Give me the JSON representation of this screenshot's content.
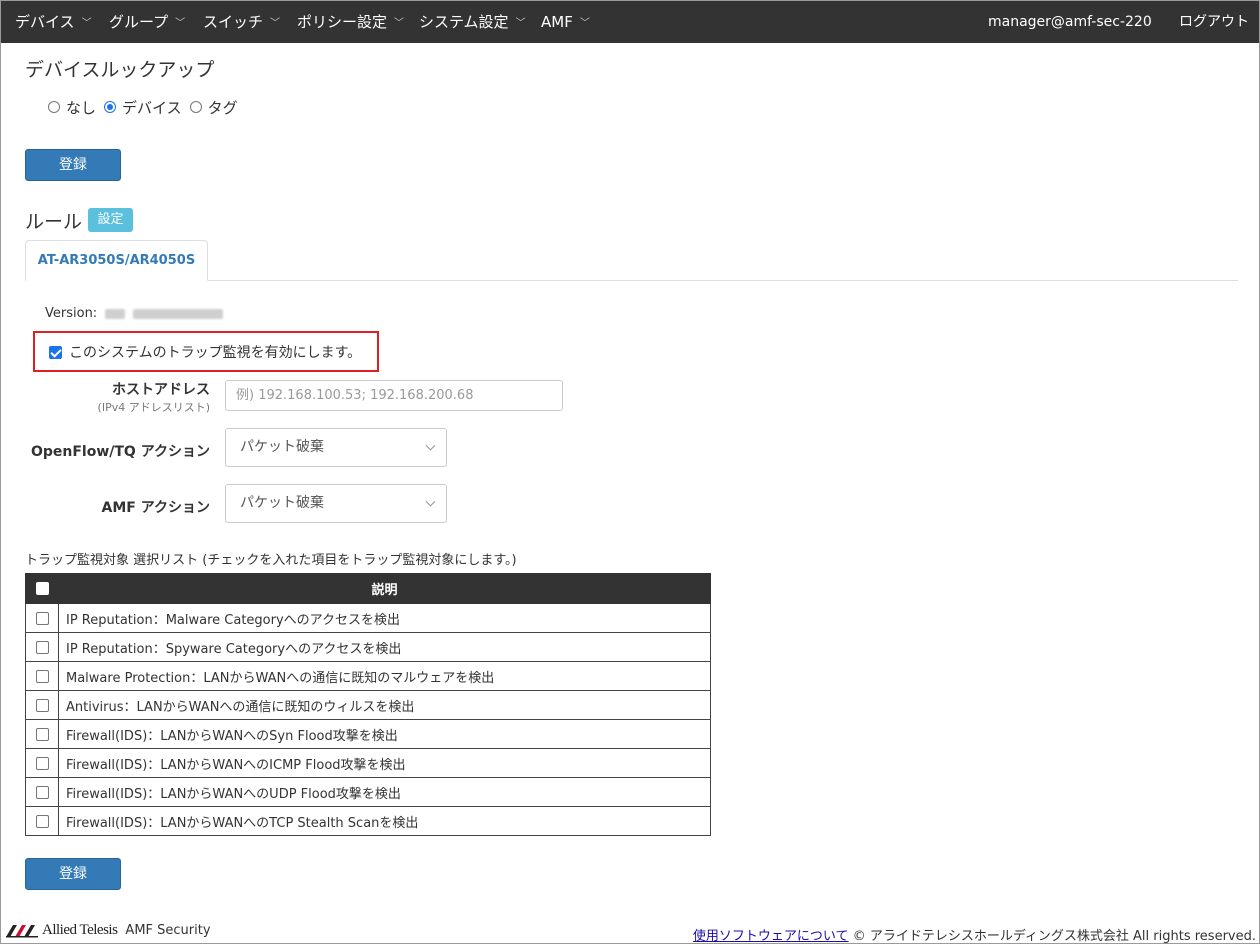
{
  "navbar": {
    "items": [
      {
        "label": "デバイス"
      },
      {
        "label": "グループ"
      },
      {
        "label": "スイッチ"
      },
      {
        "label": "ポリシー設定"
      },
      {
        "label": "システム設定"
      },
      {
        "label": "AMF"
      }
    ],
    "user": "manager@amf-sec-220",
    "logout": "ログアウト"
  },
  "device_lookup": {
    "title": "デバイスルックアップ",
    "options": [
      {
        "label": "なし",
        "selected": false
      },
      {
        "label": "デバイス",
        "selected": true
      },
      {
        "label": "タグ",
        "selected": false
      }
    ],
    "register_label": "登録"
  },
  "rules": {
    "title": "ルール",
    "settings_label": "設定",
    "tab_label": "AT-AR3050S/AR4050S",
    "version_label": "Version:",
    "enable_label": "このシステムのトラップ監視を有効にします。",
    "enable_checked": true,
    "host_label": "ホストアドレス",
    "host_sublabel": "(IPv4 アドレスリスト)",
    "host_placeholder": "例) 192.168.100.53; 192.168.200.68",
    "openflow_label": "OpenFlow/TQ アクション",
    "openflow_value": "パケット破棄",
    "amf_label": "AMF アクション",
    "amf_value": "パケット破棄",
    "list_title": "トラップ監視対象 選択リスト (チェックを入れた項目をトラップ監視対象にします。)",
    "table_header": "説明",
    "rows": [
      "IP Reputation：Malware Categoryへのアクセスを検出",
      "IP Reputation：Spyware Categoryへのアクセスを検出",
      "Malware Protection：LANからWANへの通信に既知のマルウェアを検出",
      "Antivirus：LANからWANへの通信に既知のウィルスを検出",
      "Firewall(IDS)：LANからWANへのSyn Flood攻撃を検出",
      "Firewall(IDS)：LANからWANへのICMP Flood攻撃を検出",
      "Firewall(IDS)：LANからWANへのUDP Flood攻撃を検出",
      "Firewall(IDS)：LANからWANへのTCP Stealth Scanを検出"
    ],
    "register_label": "登録"
  },
  "footer": {
    "brand": "Allied Telesis",
    "product": "AMF Security",
    "software_link": "使用ソフトウェアについて",
    "copyright": "© アライドテレシスホールディングス株式会社 All rights reserved."
  },
  "colors": {
    "navbar": "#333333",
    "primary": "#337ab7",
    "info": "#5bc0de",
    "highlight": "#e02020"
  }
}
